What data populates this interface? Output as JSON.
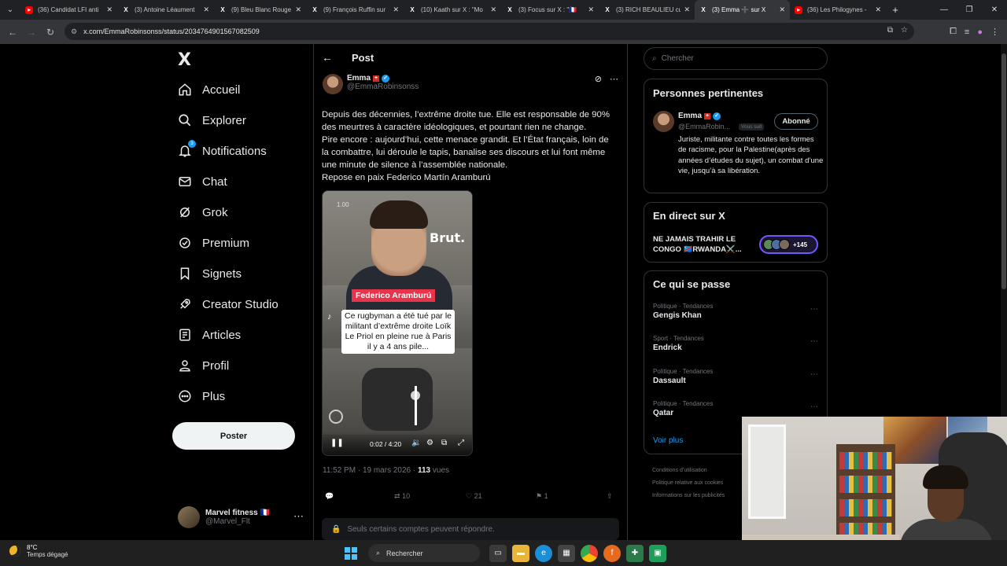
{
  "browser": {
    "tabs": [
      {
        "title": "(36) Candidat LFI anti",
        "favicon": "youtube",
        "active": false
      },
      {
        "title": "(3) Antoine Léaument",
        "favicon": "x",
        "active": false
      },
      {
        "title": "(9) Bleu Blanc Rouge",
        "favicon": "x",
        "active": false
      },
      {
        "title": "(9) François Ruffin sur",
        "favicon": "x",
        "active": false
      },
      {
        "title": "(10) Kaath sur X : \"Mo",
        "favicon": "x",
        "active": false
      },
      {
        "title": "(3) Focus sur X : \"🇫🇷",
        "favicon": "x",
        "active": false
      },
      {
        "title": "(3) RICH BEAULIEU cu",
        "favicon": "x",
        "active": false
      },
      {
        "title": "(3) Emma ➕ sur X",
        "favicon": "x",
        "active": true
      },
      {
        "title": "(36) Les Philogynes -",
        "favicon": "youtube",
        "active": false
      }
    ],
    "url": "x.com/EmmaRobinsonss/status/2034764901567082509"
  },
  "nav": {
    "logo": "X",
    "items": [
      {
        "label": "Accueil",
        "icon": "home-icon"
      },
      {
        "label": "Explorer",
        "icon": "search-icon"
      },
      {
        "label": "Notifications",
        "icon": "bell-icon",
        "badge": "3"
      },
      {
        "label": "Chat",
        "icon": "mail-icon"
      },
      {
        "label": "Grok",
        "icon": "grok-icon"
      },
      {
        "label": "Premium",
        "icon": "verified-icon"
      },
      {
        "label": "Signets",
        "icon": "bookmark-icon"
      },
      {
        "label": "Creator Studio",
        "icon": "rocket-icon"
      },
      {
        "label": "Articles",
        "icon": "article-icon"
      },
      {
        "label": "Profil",
        "icon": "person-icon"
      },
      {
        "label": "Plus",
        "icon": "more-circle-icon"
      }
    ],
    "post_button": "Poster",
    "account": {
      "name": "Marvel fitness 🇫🇷",
      "handle": "@Marvel_Flt"
    }
  },
  "post": {
    "header_title": "Post",
    "author_name": "Emma",
    "author_handle": "@EmmaRobinsonss",
    "text_lines": [
      "Depuis des décennies, l’extrême droite tue. Elle est responsable de 90%",
      "des meurtres à caractère idéologiques, et pourtant rien ne change.",
      "Pire encore : aujourd’hui, cette menace grandit. Et l’État français, loin de",
      "la combattre, lui déroule le tapis, banalise ses discours et lui font même",
      "une minute de silence à l’assemblée nationale.",
      "Repose en paix Federico Martín Aramburú"
    ],
    "video": {
      "speed": "1.00",
      "brand": "Brut.",
      "name_tag": "Federico Aramburú",
      "caption": "Ce rugbyman a été tué par le militant d’extrême droite Loïk Le Priol en pleine rue à Paris il y a 4 ans pile...",
      "time": "0:02 / 4:20"
    },
    "timestamp": "11:52 PM · 19 mars 2026 · ",
    "views_count": "113",
    "views_label": " vues",
    "reposts": "10",
    "likes": "21",
    "bookmarks": "1",
    "reply_restriction": "Seuls certains comptes peuvent répondre."
  },
  "sidebar": {
    "search_placeholder": "Chercher",
    "relevant_title": "Personnes pertinentes",
    "person": {
      "name": "Emma",
      "handle": "@EmmaRobin...",
      "follows_you": "Vous suit",
      "button": "Abonné",
      "bio": "Juriste, militante contre toutes les formes de racisme, pour la Palestine(après des années d’études du sujet), un combat d’une vie, jusqu’à sa libération."
    },
    "live_title": "En direct sur X",
    "live_text": "NE JAMAIS TRAHIR LE CONGO 🇨🇩RWANDA⚔️...",
    "live_count": "+145",
    "trends_title": "Ce qui se passe",
    "trends": [
      {
        "category": "Politique · Tendances",
        "name": "Gengis Khan"
      },
      {
        "category": "Sport · Tendances",
        "name": "Endrick"
      },
      {
        "category": "Politique · Tendances",
        "name": "Dassault"
      },
      {
        "category": "Politique · Tendances",
        "name": "Qatar"
      }
    ],
    "see_more": "Voir plus",
    "footer_links": [
      "Conditions d’utilisation",
      "Politique relative aux cookies",
      "Informations sur les publicités"
    ]
  },
  "taskbar": {
    "temperature": "8°C",
    "weather": "Temps dégagé",
    "search": "Rechercher"
  }
}
